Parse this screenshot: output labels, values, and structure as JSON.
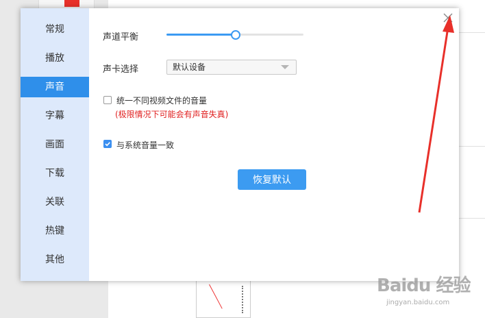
{
  "sidebar": {
    "items": [
      {
        "label": "常规",
        "active": false
      },
      {
        "label": "播放",
        "active": false
      },
      {
        "label": "声音",
        "active": true
      },
      {
        "label": "字幕",
        "active": false
      },
      {
        "label": "画面",
        "active": false
      },
      {
        "label": "下载",
        "active": false
      },
      {
        "label": "关联",
        "active": false
      },
      {
        "label": "热键",
        "active": false
      },
      {
        "label": "其他",
        "active": false
      }
    ]
  },
  "sound": {
    "balance_label": "声道平衡",
    "balance_value": 0.5,
    "card_label": "声卡选择",
    "card_selected": "默认设备",
    "unify_volume_label": "统一不同视频文件的音量",
    "unify_volume_checked": false,
    "unify_volume_warning": "(极限情况下可能会有声音失真)",
    "sync_system_label": "与系统音量一致",
    "sync_system_checked": true,
    "restore_button": "恢复默认"
  },
  "watermark": {
    "logo": "Baidu 经验",
    "sub": "jingyan.baidu.com"
  },
  "colors": {
    "accent": "#2f8fea",
    "sidebar_bg": "#dde9fb",
    "warning": "#e02020",
    "annotation": "#e8302a"
  },
  "icons": {
    "close": "close-icon",
    "dropdown": "chevron-down-icon",
    "check": "check-icon"
  }
}
